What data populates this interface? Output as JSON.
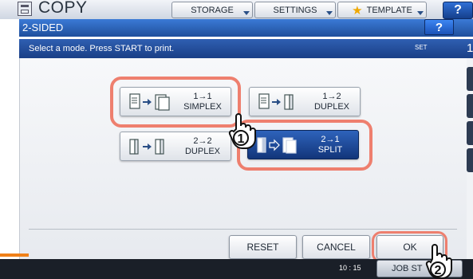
{
  "app": {
    "title": "COPY",
    "tabs": [
      {
        "label": "STORAGE"
      },
      {
        "label": "SETTINGS"
      },
      {
        "label": "TEMPLATE"
      }
    ],
    "help_label": "?"
  },
  "dialog": {
    "title": "2-SIDED",
    "help_label": "?",
    "message": "Select a mode. Press START to print.",
    "set_label": "SET",
    "set_value": "1"
  },
  "modes": [
    {
      "line1": "1→1",
      "line2": "SIMPLEX",
      "icon": "simplex-icon",
      "selected": false
    },
    {
      "line1": "1→2",
      "line2": "DUPLEX",
      "icon": "duplex-1-2-icon",
      "selected": false
    },
    {
      "line1": "2→2",
      "line2": "DUPLEX",
      "icon": "duplex-2-2-icon",
      "selected": false
    },
    {
      "line1": "2→1",
      "line2": "SPLIT",
      "icon": "split-icon",
      "selected": true
    }
  ],
  "buttons": {
    "reset": "RESET",
    "cancel": "CANCEL",
    "ok": "OK"
  },
  "footer": {
    "clock": "10 : 15",
    "job_status": "JOB ST"
  },
  "callouts": {
    "step1": "1",
    "step2": "2"
  },
  "colors": {
    "header_blue": "#2a63bf",
    "selected_blue": "#12357a",
    "highlight": "#ee7f6e",
    "star": "#f0a800"
  }
}
